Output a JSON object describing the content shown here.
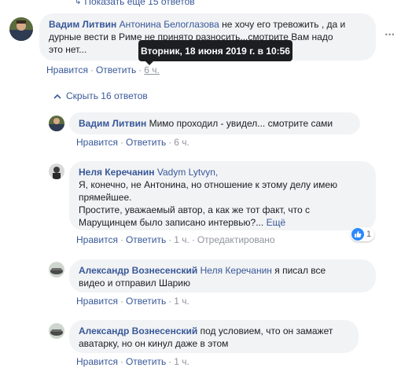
{
  "top": {
    "show_more_label": "Показать еще 15 ответов"
  },
  "tooltip": {
    "text": "Вторник, 18 июня 2019 г. в 10:56"
  },
  "hide_replies": {
    "label": "Скрыть 16 ответов"
  },
  "actions": {
    "like": "Нравится",
    "reply": "Ответить",
    "edited": "Отредактировано",
    "separator": "·"
  },
  "comments": [
    {
      "author": "Вадим Литвин",
      "mention": "Антонина Белоглазова",
      "text_line1": " не хочу его тревожить , да и",
      "text_line2": "дурные вести в Риме не принято разносить...смотрите Вам надо",
      "text_line3": "это нет...",
      "time": "6 ч."
    },
    {
      "author": "Вадим Литвин",
      "text": " Мимо проходил - увидел... смотрите сами",
      "time": "6 ч."
    },
    {
      "author": "Неля Керечанин",
      "mention": "Vadym Lytvyn,",
      "text_line2": "Я, конечно, не Антонина, но отношение к этому делу имею",
      "text_line3": "прямейшее.",
      "text_line4": "Простите, уважаемый автор, а как же тот факт, что с",
      "text_line5": "Марущинцем было записано интервью?...",
      "more": "Ещё",
      "time": "1 ч.",
      "reaction_count": "1"
    },
    {
      "author": "Александр Вознесенский",
      "mention": "Неля Керечанин",
      "text_line1": " я писал все",
      "text_line2": "видео и отправил Шарию",
      "time": "1 ч."
    },
    {
      "author": "Александр Вознесенский",
      "text_line1": " под условием, что он замажет",
      "text_line2": "аватарку, но он кинул даже в этом",
      "time": "1 ч."
    }
  ],
  "colors": {
    "link": "#385898",
    "bubble": "#f2f3f5",
    "muted": "#90949c",
    "like": "#2d88ff"
  }
}
